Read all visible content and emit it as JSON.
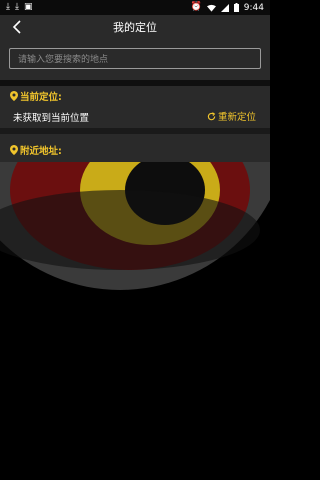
{
  "status_bar": {
    "time": "9:44",
    "left_icons": [
      "download-icon",
      "download-icon",
      "android-debug-icon"
    ],
    "right_icons": [
      "alarm-icon",
      "wifi-icon",
      "signal-icon",
      "battery-icon"
    ]
  },
  "header": {
    "title": "我的定位",
    "back_icon": "chevron-left-icon"
  },
  "search": {
    "placeholder": "请输入您要搜索的地点"
  },
  "current_location": {
    "heading": "当前定位:",
    "status_text": "未获取到当前位置",
    "relocate_label": "重新定位"
  },
  "nearby": {
    "heading": "附近地址:"
  },
  "colors": {
    "accent": "#f0c42c",
    "panel": "#2a2a2a",
    "background": "#000000"
  }
}
